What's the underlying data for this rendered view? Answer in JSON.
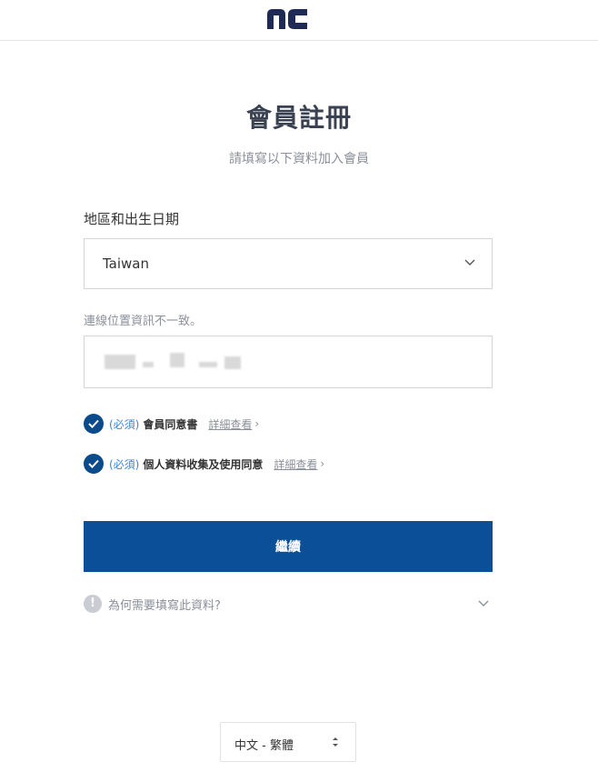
{
  "header": {
    "logo_icon": "nc-logo",
    "brand_color": "#1f2a55"
  },
  "page": {
    "title": "會員註冊",
    "subtitle": "請填寫以下資料加入會員"
  },
  "region": {
    "label": "地區和出生日期",
    "selected": "Taiwan",
    "icon": "chevron-down-icon"
  },
  "notice": "連線位置資訊不一致。",
  "birth_input": {
    "value": "",
    "obscured": true
  },
  "agreements": [
    {
      "required": "(必須)",
      "label": "會員同意書",
      "link": "詳細查看",
      "checked": true
    },
    {
      "required": "(必須)",
      "label": "個人資料收集及使用同意",
      "link": "詳細查看",
      "checked": true
    }
  ],
  "continue_button": {
    "label": "繼續",
    "color": "#0b4f99"
  },
  "faq": {
    "icon": "!",
    "text": "為何需要填寫此資料?"
  },
  "language": {
    "selected": "中文 - 繁體",
    "icon": "sort-arrows-icon"
  },
  "colors": {
    "accent": "#0b4f99",
    "check": "#0b4a8b",
    "required_text": "#3b86d6"
  }
}
